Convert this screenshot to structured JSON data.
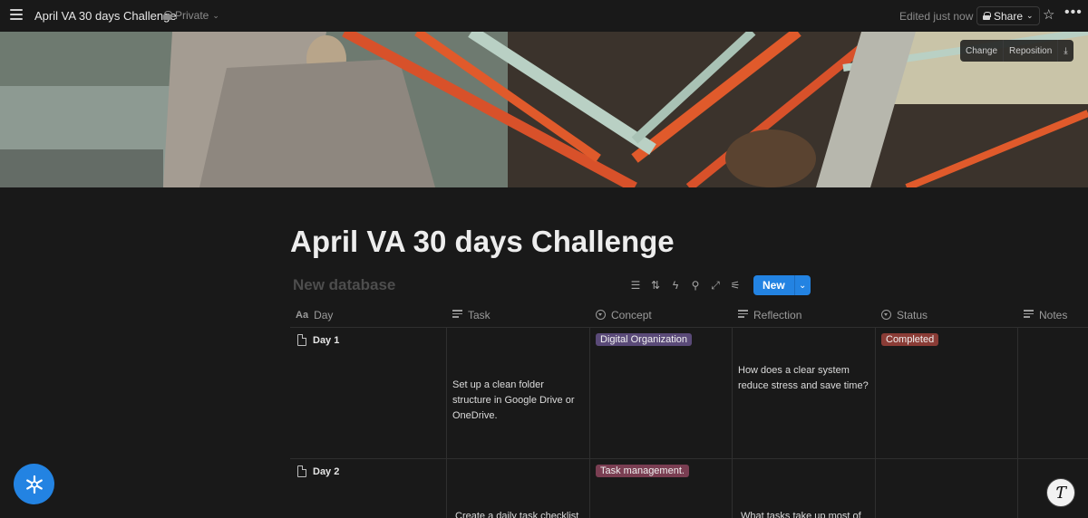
{
  "topbar": {
    "page_title": "April VA 30 days Challenge",
    "privacy": "Private",
    "edited": "Edited just now",
    "share_label": "Share"
  },
  "cover": {
    "change_label": "Change",
    "reposition_label": "Reposition"
  },
  "page": {
    "title": "April VA 30 days Challenge",
    "database_title": "New database",
    "new_button": "New"
  },
  "table": {
    "columns": [
      {
        "label": "Day",
        "icon": "title-icon"
      },
      {
        "label": "Task",
        "icon": "text-icon"
      },
      {
        "label": "Concept",
        "icon": "select-icon"
      },
      {
        "label": "Reflection",
        "icon": "text-icon"
      },
      {
        "label": "Status",
        "icon": "select-icon"
      },
      {
        "label": "Notes",
        "icon": "text-icon"
      }
    ],
    "rows": [
      {
        "day": "Day 1",
        "task": "Set up a clean folder structure in Google Drive or OneDrive.",
        "concept": "Digital Organization",
        "concept_color": "#5a4a78",
        "reflection": "How does a clear system reduce stress and save time?",
        "status": "Completed",
        "status_color": "#8a3c36"
      },
      {
        "day": "Day 2",
        "task": "Create a daily task checklist",
        "concept": "Task management.",
        "concept_color": "#7a3e52",
        "reflection": "What tasks take up most of",
        "status": "",
        "status_color": ""
      }
    ]
  },
  "colors": {
    "accent": "#2383e2",
    "background": "#191919"
  }
}
